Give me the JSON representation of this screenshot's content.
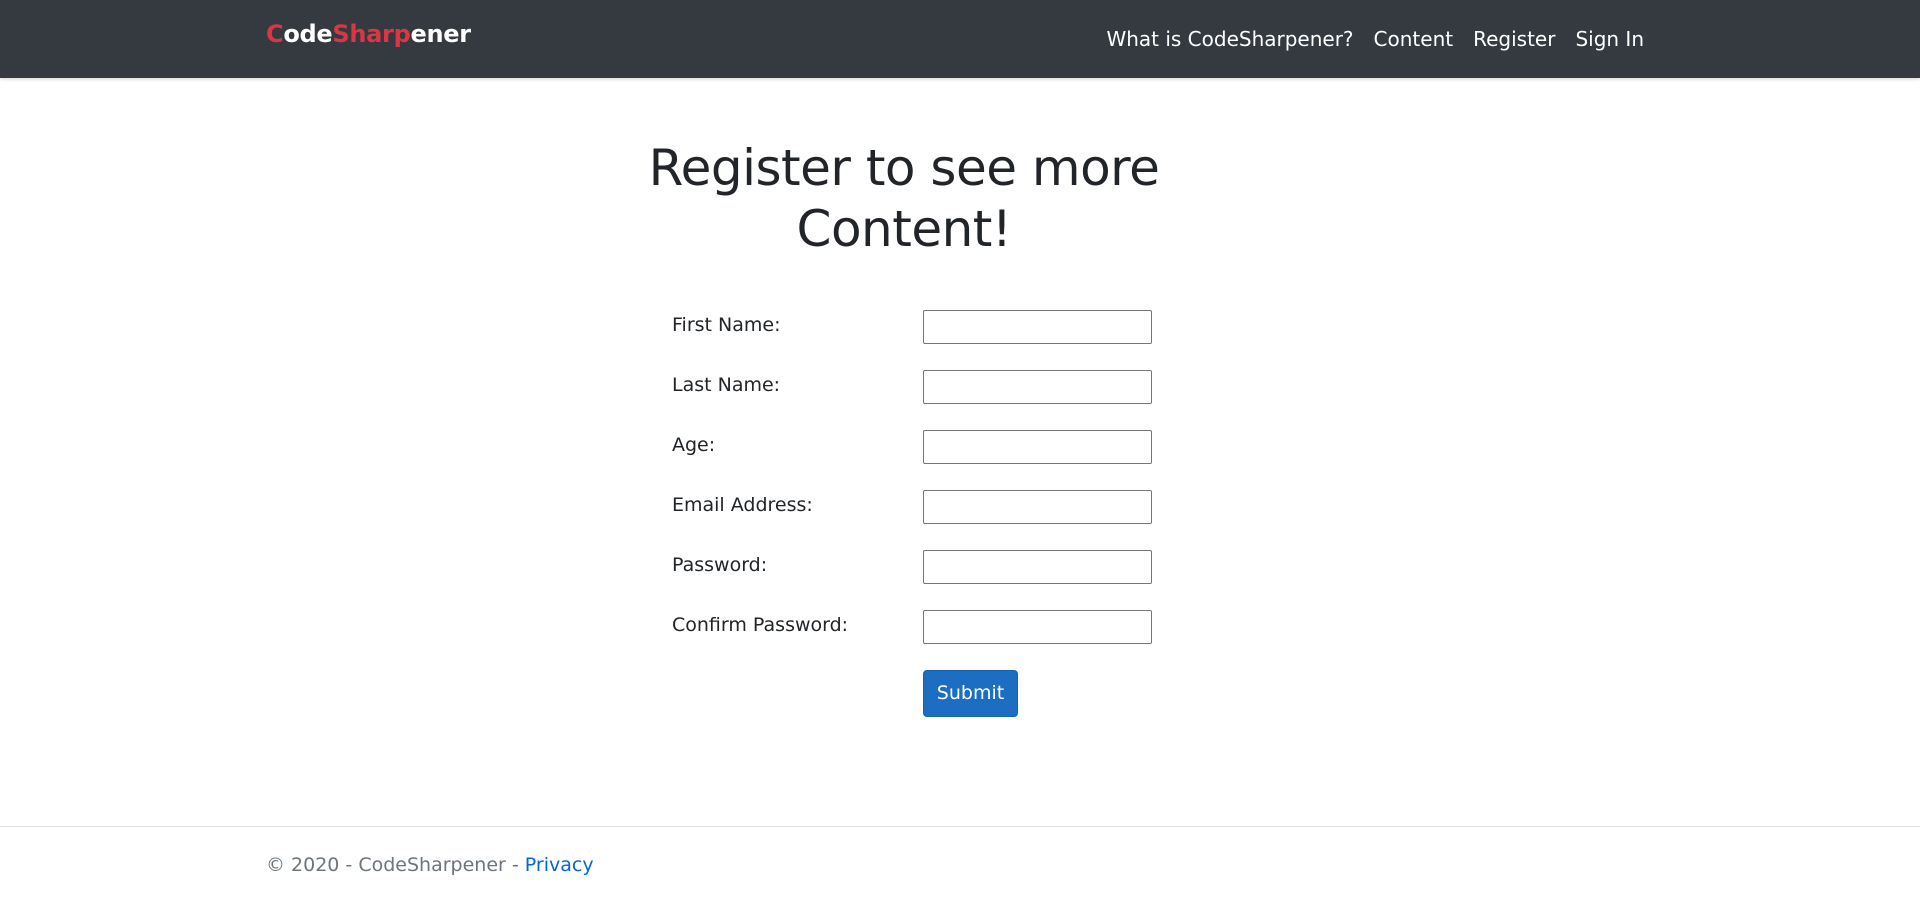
{
  "brand": {
    "part1": "C",
    "part2": "ode",
    "part3": "Sharp",
    "part4": "ener"
  },
  "nav": {
    "items": [
      {
        "label": "What is CodeSharpener?"
      },
      {
        "label": "Content"
      },
      {
        "label": "Register"
      },
      {
        "label": "Sign In"
      }
    ]
  },
  "main": {
    "heading_line1": "Register to see more",
    "heading_line2": "Content!"
  },
  "form": {
    "fields": [
      {
        "label": "First Name:",
        "value": ""
      },
      {
        "label": "Last Name:",
        "value": ""
      },
      {
        "label": "Age:",
        "value": ""
      },
      {
        "label": "Email Address:",
        "value": ""
      },
      {
        "label": "Password:",
        "value": ""
      },
      {
        "label": "Confirm Password:",
        "value": ""
      }
    ],
    "submit_label": "Submit"
  },
  "footer": {
    "copyright": "© 2020 - CodeSharpener - ",
    "privacy_label": "Privacy"
  },
  "colors": {
    "navbar_bg": "#343a40",
    "brand_accent": "#dc3545",
    "button_primary": "#1b6ec2",
    "link": "#0366d6"
  }
}
